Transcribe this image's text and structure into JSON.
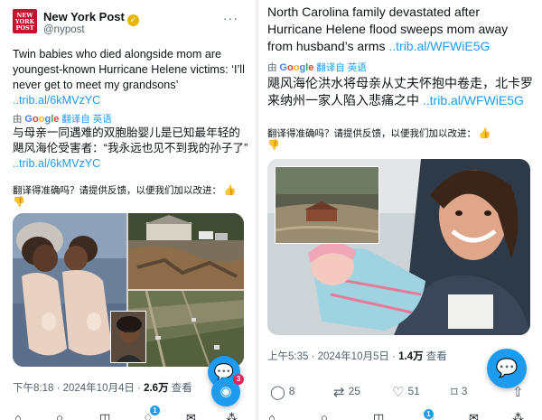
{
  "left": {
    "account": {
      "name": "New York Post",
      "handle": "@nypost",
      "logo_text": "NEW YORK POST"
    },
    "tweet_text": "Twin babies who died alongside mom are youngest-known Hurricane Helene victims: ‘I’ll never get to meet my grandsons’",
    "tweet_link": "trib.al/6kMVzYC",
    "translated_by": {
      "prefix": "由",
      "google": "Google",
      "suffix": "翻译自 英语"
    },
    "translation_text": "与母亲一同遇难的双胞胎婴儿是已知最年轻的飓风海伦受害者：“我永远也见不到我的孙子了”",
    "translation_link": "trib.al/6kMVzYC",
    "feedback": "翻译得准确吗？请提供反馈，以便我们加以改进：",
    "timestamp": "下午8:18 · 2024年10月4日 · ",
    "views": "2.6万",
    "views_label": " 查看",
    "spaces_badge": "3",
    "nav_badge": "1"
  },
  "right": {
    "tweet_text": "North Carolina family devastated after Hurricane Helene flood sweeps mom away from husband’s arms",
    "tweet_link": "trib.al/WFWiE5G",
    "translated_by": {
      "prefix": "由",
      "google": "Google",
      "suffix": "翻译自 英语"
    },
    "translation_text": "飓风海伦洪水将母亲从丈夫怀抱中卷走，北卡罗来纳州一家人陷入悲痛之中",
    "translation_link": "trib.al/WFWiE5G",
    "feedback": "翻译得准确吗？请提供反馈，以便我们加以改进：",
    "timestamp": "上午5:35 · 2024年10月5日 · ",
    "views": "1.4万",
    "views_label": " 查看",
    "replies": "8",
    "retweets": "25",
    "likes": "51",
    "bookmarks": "3",
    "nav_badge": "1"
  },
  "icons": {
    "verified": "✓",
    "more": "···",
    "thumb": "👍",
    "thumbdown": "👎",
    "reply": "💬",
    "retweet": "⇄",
    "like": "♡",
    "bookmark": "🔖",
    "share": "⇧"
  },
  "colors": {
    "link": "#1d9bf0",
    "brand": "#c8102e",
    "badge": "#e0245e"
  }
}
